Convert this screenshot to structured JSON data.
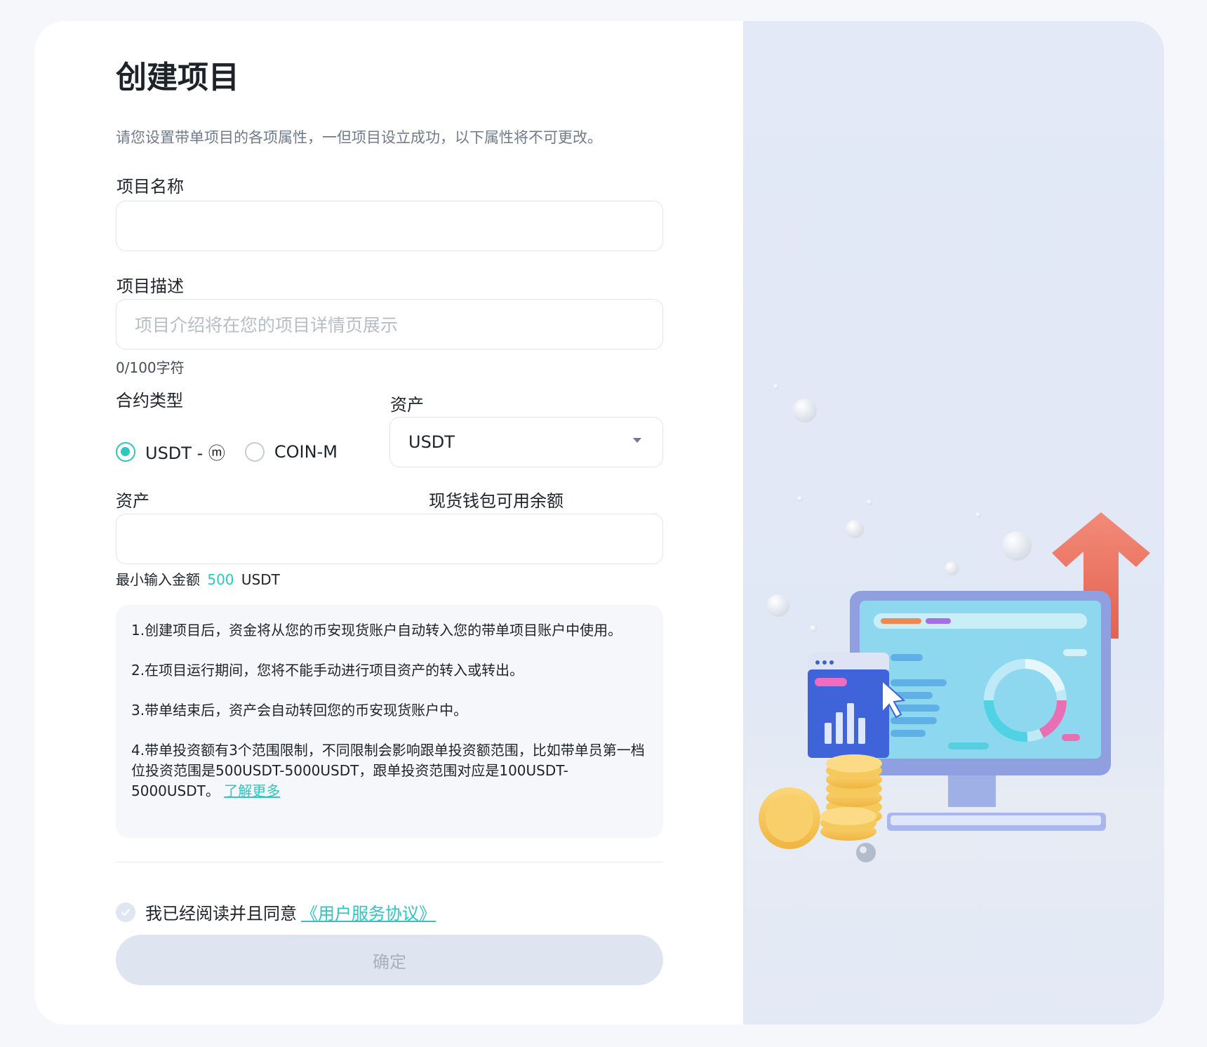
{
  "form": {
    "title": "创建项目",
    "subtitle": "请您设置带单项目的各项属性，一但项目设立成功，以下属性将不可更改。",
    "name_label": "项目名称",
    "name_value": "",
    "desc_label": "项目描述",
    "desc_placeholder": "项目介绍将在您的项目详情页展示",
    "desc_counter": "0/100字符",
    "contract_label": "合约类型",
    "contract_options": [
      {
        "label": "USDT - ⓜ",
        "selected": true
      },
      {
        "label": "COIN-M",
        "selected": false
      }
    ],
    "asset_select_label": "资产",
    "asset_select_value": "USDT",
    "amount_label": "资产",
    "balance_label": "现货钱包可用余额",
    "amount_value": "",
    "min_prefix": "最小输入金额",
    "min_amount": "500",
    "min_unit": "USDT"
  },
  "notes": {
    "items": [
      "1.创建项目后，资金将从您的币安现货账户自动转入您的带单项目账户中使用。",
      "2.在项目运行期间，您将不能手动进行项目资产的转入或转出。",
      "3.带单结束后，资产会自动转回您的币安现货账户中。",
      "4.带单投资额有3个范围限制，不同限制会影响跟单投资额范围，比如带单员第一档位投资范围是500USDT-5000USDT，跟单投资范围对应是100USDT-5000USDT。"
    ],
    "learn_more": "了解更多"
  },
  "agreement": {
    "text": "我已经阅读并且同意",
    "link": "《用户服务协议》",
    "checked": true
  },
  "submit_label": "确定",
  "colors": {
    "accent": "#2ec6c0",
    "button_disabled": "#dfe5f0",
    "panel_bg": "#e3e9f6"
  },
  "illustration": {
    "icon": "monitor-chart-arrow-illustration"
  }
}
